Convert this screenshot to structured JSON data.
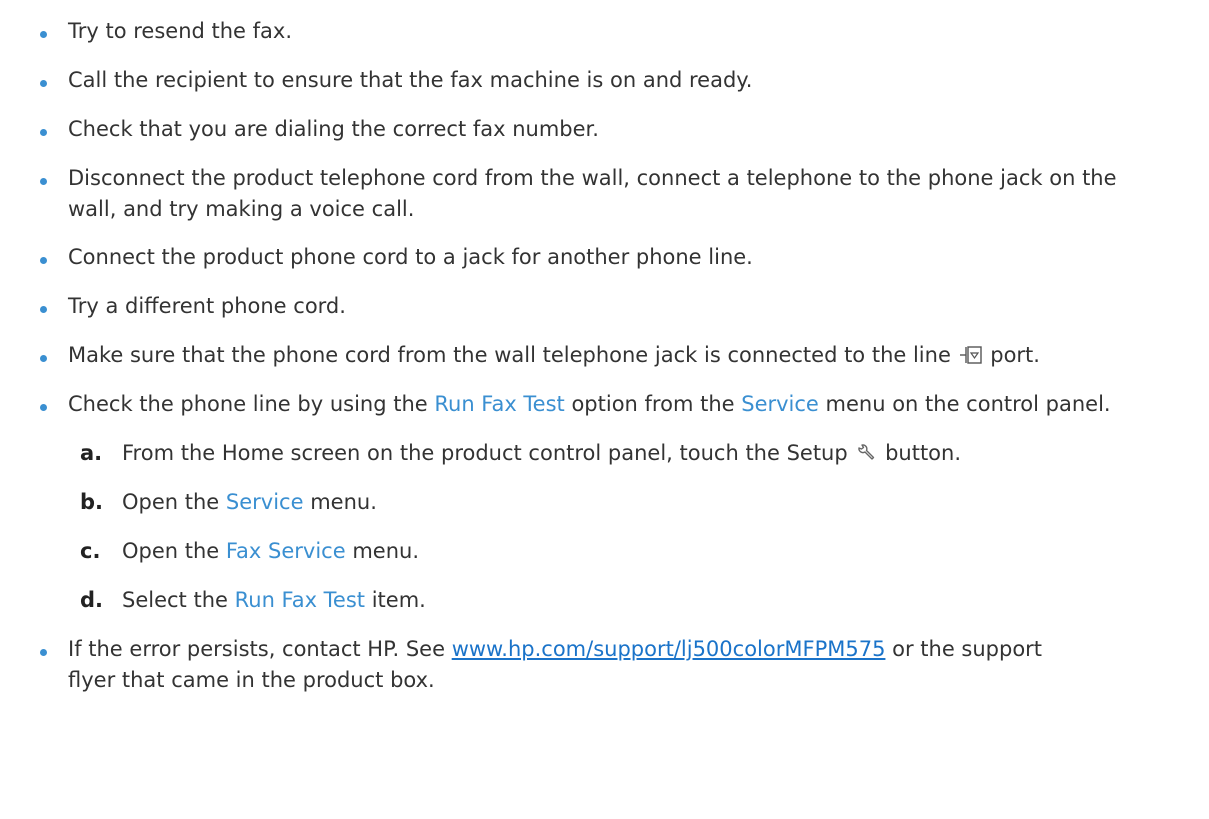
{
  "colors": {
    "accent": "#3a8fd1",
    "text": "#333333",
    "link": "#1a73c9"
  },
  "bullets": [
    {
      "text": "Try to resend the fax."
    },
    {
      "text": "Call the recipient to ensure that the fax machine is on and ready."
    },
    {
      "text": "Check that you are dialing the correct fax number."
    },
    {
      "line1": "Disconnect the product telephone cord from the wall, connect a telephone to the phone jack on the",
      "line2": "wall, and try making a voice call."
    },
    {
      "text": "Connect the product phone cord to a jack for another phone line."
    },
    {
      "text": "Try a different phone cord."
    },
    {
      "before": "Make sure that the phone cord from the wall telephone jack is connected to the line",
      "icon": "line-port-icon",
      "after": "port."
    },
    {
      "p1": "Check the phone line by using the ",
      "m1": "Run Fax Test",
      "p2": " option from the ",
      "m2": "Service",
      "p3": " menu on the control panel."
    }
  ],
  "steps": [
    {
      "letter": "a.",
      "before": "From the Home screen on the product control panel, touch the Setup",
      "icon": "wrench-icon",
      "after": "button."
    },
    {
      "letter": "b.",
      "before": "Open the ",
      "menu": "Service",
      "after": " menu."
    },
    {
      "letter": "c.",
      "before": "Open the ",
      "menu": "Fax Service",
      "after": " menu."
    },
    {
      "letter": "d.",
      "before": "Select the ",
      "menu": "Run Fax Test",
      "after": " item."
    }
  ],
  "last": {
    "before": "If the error persists, contact HP. See ",
    "link": "www.hp.com/support/lj500colorMFPM575",
    "after": " or the support",
    "line2": "flyer that came in the product box."
  }
}
